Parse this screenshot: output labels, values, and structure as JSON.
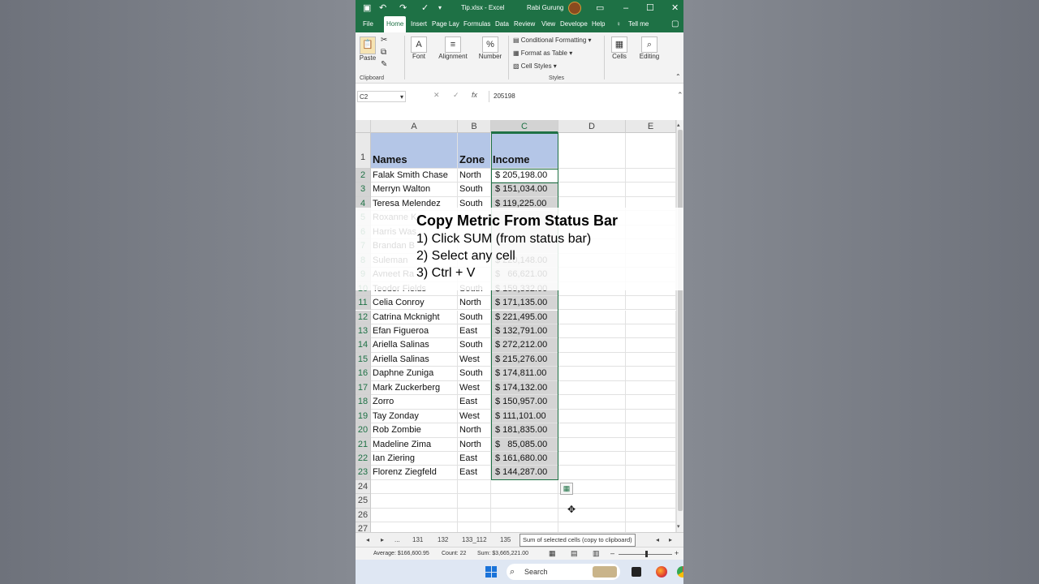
{
  "titlebar": {
    "file_title": "Tip.xlsx  -  Excel",
    "user_name": "Rabi Gurung"
  },
  "tabs": [
    "File",
    "Home",
    "Insert",
    "Page Lay",
    "Formulas",
    "Data",
    "Review",
    "View",
    "Develope",
    "Help"
  ],
  "tell_me": "Tell me",
  "ribbon": {
    "paste": "Paste",
    "clipboard": "Clipboard",
    "font": "Font",
    "alignment": "Alignment",
    "number": "Number",
    "conditional_formatting": "Conditional Formatting",
    "format_as_table": "Format as Table",
    "cell_styles": "Cell Styles",
    "styles": "Styles",
    "cells": "Cells",
    "editing": "Editing"
  },
  "formula_bar": {
    "name_box": "C2",
    "value": "205198"
  },
  "columns": [
    "A",
    "B",
    "C",
    "D",
    "E"
  ],
  "header_row": {
    "names": "Names",
    "zone": "Zone",
    "income": "Income"
  },
  "rows": [
    {
      "n": "2",
      "name": "Falak Smith Chase",
      "zone": "North",
      "income": "$ 205,198.00"
    },
    {
      "n": "3",
      "name": "Merryn Walton",
      "zone": "South",
      "income": "$ 151,034.00"
    },
    {
      "n": "4",
      "name": "Teresa Melendez",
      "zone": "South",
      "income": "$ 119,225.00"
    },
    {
      "n": "5",
      "name": "Roxanne K",
      "zone": "",
      "income": ""
    },
    {
      "n": "6",
      "name": "Harris Was",
      "zone": "",
      "income": ""
    },
    {
      "n": "7",
      "name": "Brandan B",
      "zone": "",
      "income": ""
    },
    {
      "n": "8",
      "name": "Suleman",
      "zone": "",
      "income": "$ 220,148.00"
    },
    {
      "n": "9",
      "name": "Avneet Ra",
      "zone": "",
      "income": "$   66,621.00"
    },
    {
      "n": "10",
      "name": "Teodor Fields",
      "zone": "South",
      "income": "$ 159,332.00"
    },
    {
      "n": "11",
      "name": "Celia Conroy",
      "zone": "North",
      "income": "$ 171,135.00"
    },
    {
      "n": "12",
      "name": "Catrina Mcknight",
      "zone": "South",
      "income": "$ 221,495.00"
    },
    {
      "n": "13",
      "name": "Efan Figueroa",
      "zone": "East",
      "income": "$ 132,791.00"
    },
    {
      "n": "14",
      "name": "Ariella Salinas",
      "zone": "South",
      "income": "$ 272,212.00"
    },
    {
      "n": "15",
      "name": "Ariella Salinas",
      "zone": "West",
      "income": "$ 215,276.00"
    },
    {
      "n": "16",
      "name": "Daphne Zuniga",
      "zone": "South",
      "income": "$ 174,811.00"
    },
    {
      "n": "17",
      "name": "Mark Zuckerberg",
      "zone": "West",
      "income": "$ 174,132.00"
    },
    {
      "n": "18",
      "name": "Zorro",
      "zone": "East",
      "income": "$ 150,957.00"
    },
    {
      "n": "19",
      "name": "Tay Zonday",
      "zone": "West",
      "income": "$ 111,101.00"
    },
    {
      "n": "20",
      "name": "Rob Zombie",
      "zone": "North",
      "income": "$ 181,835.00"
    },
    {
      "n": "21",
      "name": "Madeline Zima",
      "zone": "North",
      "income": "$   85,085.00"
    },
    {
      "n": "22",
      "name": "Ian Ziering",
      "zone": "East",
      "income": "$ 161,680.00"
    },
    {
      "n": "23",
      "name": "Florenz Ziegfeld",
      "zone": "East",
      "income": "$ 144,287.00"
    }
  ],
  "empty_rows": [
    "24",
    "25",
    "26",
    "27"
  ],
  "overlay": {
    "title": "Copy Metric From Status Bar",
    "step1": "1) Click SUM (from status bar)",
    "step2": "2) Select any cell",
    "step3": "3) Ctrl + V"
  },
  "sheet_tabs": {
    "ellipsis": "...",
    "tab1": "131",
    "tab2": "132",
    "tab3": "133_112",
    "tab4": "135",
    "tooltip": "Sum of selected cells (copy to clipboard)"
  },
  "status": {
    "average": "Average:  $166,600.95",
    "count": "Count: 22",
    "sum": "Sum:  $3,665,221.00"
  },
  "taskbar": {
    "search": "Search"
  },
  "colors": {
    "excel_green": "#1e7145",
    "header_fill": "#b4c6e7"
  }
}
